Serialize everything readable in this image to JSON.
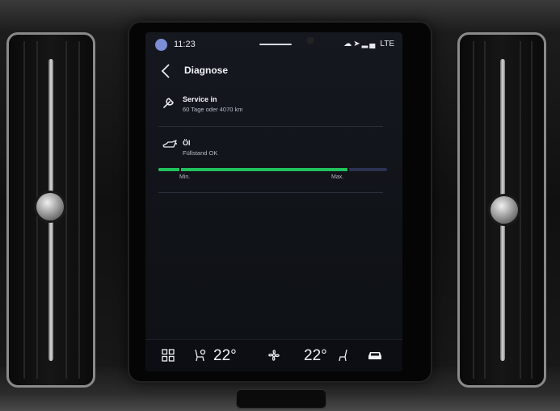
{
  "status": {
    "time": "11:23",
    "network": "LTE"
  },
  "header": {
    "title": "Diagnose"
  },
  "service": {
    "title": "Service in",
    "subtitle": "60 Tage oder 4070 km"
  },
  "oil": {
    "title": "Öl",
    "subtitle": "Füllstand OK",
    "level_fraction": 0.83,
    "min_label": "Min.",
    "max_label": "Max."
  },
  "climate": {
    "driver_temp": "22°",
    "passenger_temp": "22°"
  },
  "colors": {
    "accent_green": "#21c25d",
    "gauge_track": "#2a3250",
    "screen_bg": "#12151b"
  },
  "icons": {
    "wrench": "wrench-icon",
    "oil_can": "oil-can-icon",
    "apps": "app-grid-icon",
    "seat_heat": "seat-heat-icon",
    "fan": "fan-icon",
    "car": "car-icon"
  }
}
